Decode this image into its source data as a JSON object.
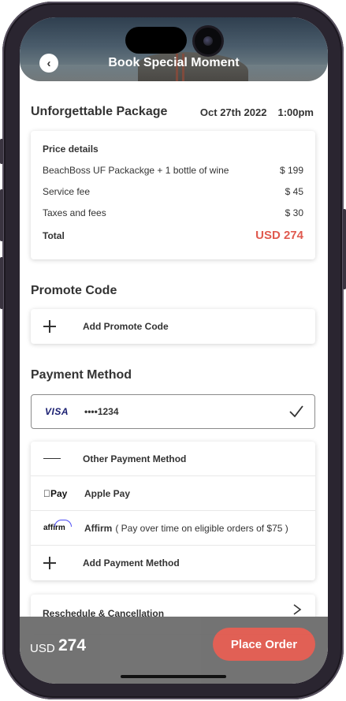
{
  "header": {
    "title": "Book Special Moment",
    "back_icon": "back-arrow-icon",
    "back_glyph": "‹"
  },
  "package": {
    "title": "Unforgettable Package",
    "date": "Oct 27th 2022",
    "time": "1:00pm"
  },
  "price_details": {
    "title": "Price details",
    "lines": [
      {
        "label": "BeachBoss UF Packackge + 1 bottle of wine",
        "amount": "$ 199"
      },
      {
        "label": "Service fee",
        "amount": "$ 45"
      },
      {
        "label": "Taxes and fees",
        "amount": "$ 30"
      }
    ],
    "total_label": "Total",
    "total_amount": "USD 274"
  },
  "promote": {
    "title": "Promote Code",
    "add_label": "Add Promote Code"
  },
  "payment": {
    "title": "Payment Method",
    "selected": {
      "brand": "VISA",
      "number": "••••1234"
    },
    "methods": {
      "other": "Other Payment Method",
      "apple_logo": "Pay",
      "apple": "Apple Pay",
      "affirm_logo": "affirm",
      "affirm": "Affirm",
      "affirm_note": "( Pay over time on eligible orders of $75 )",
      "add": "Add Payment Method"
    }
  },
  "reschedule": {
    "label": "Reschedule & Cancellation"
  },
  "footer": {
    "currency": "USD",
    "amount": "274",
    "order_label": "Place Order"
  },
  "colors": {
    "accent": "#e05a4f",
    "visa": "#1a1f71",
    "footer_bg": "#6e6e6e"
  }
}
